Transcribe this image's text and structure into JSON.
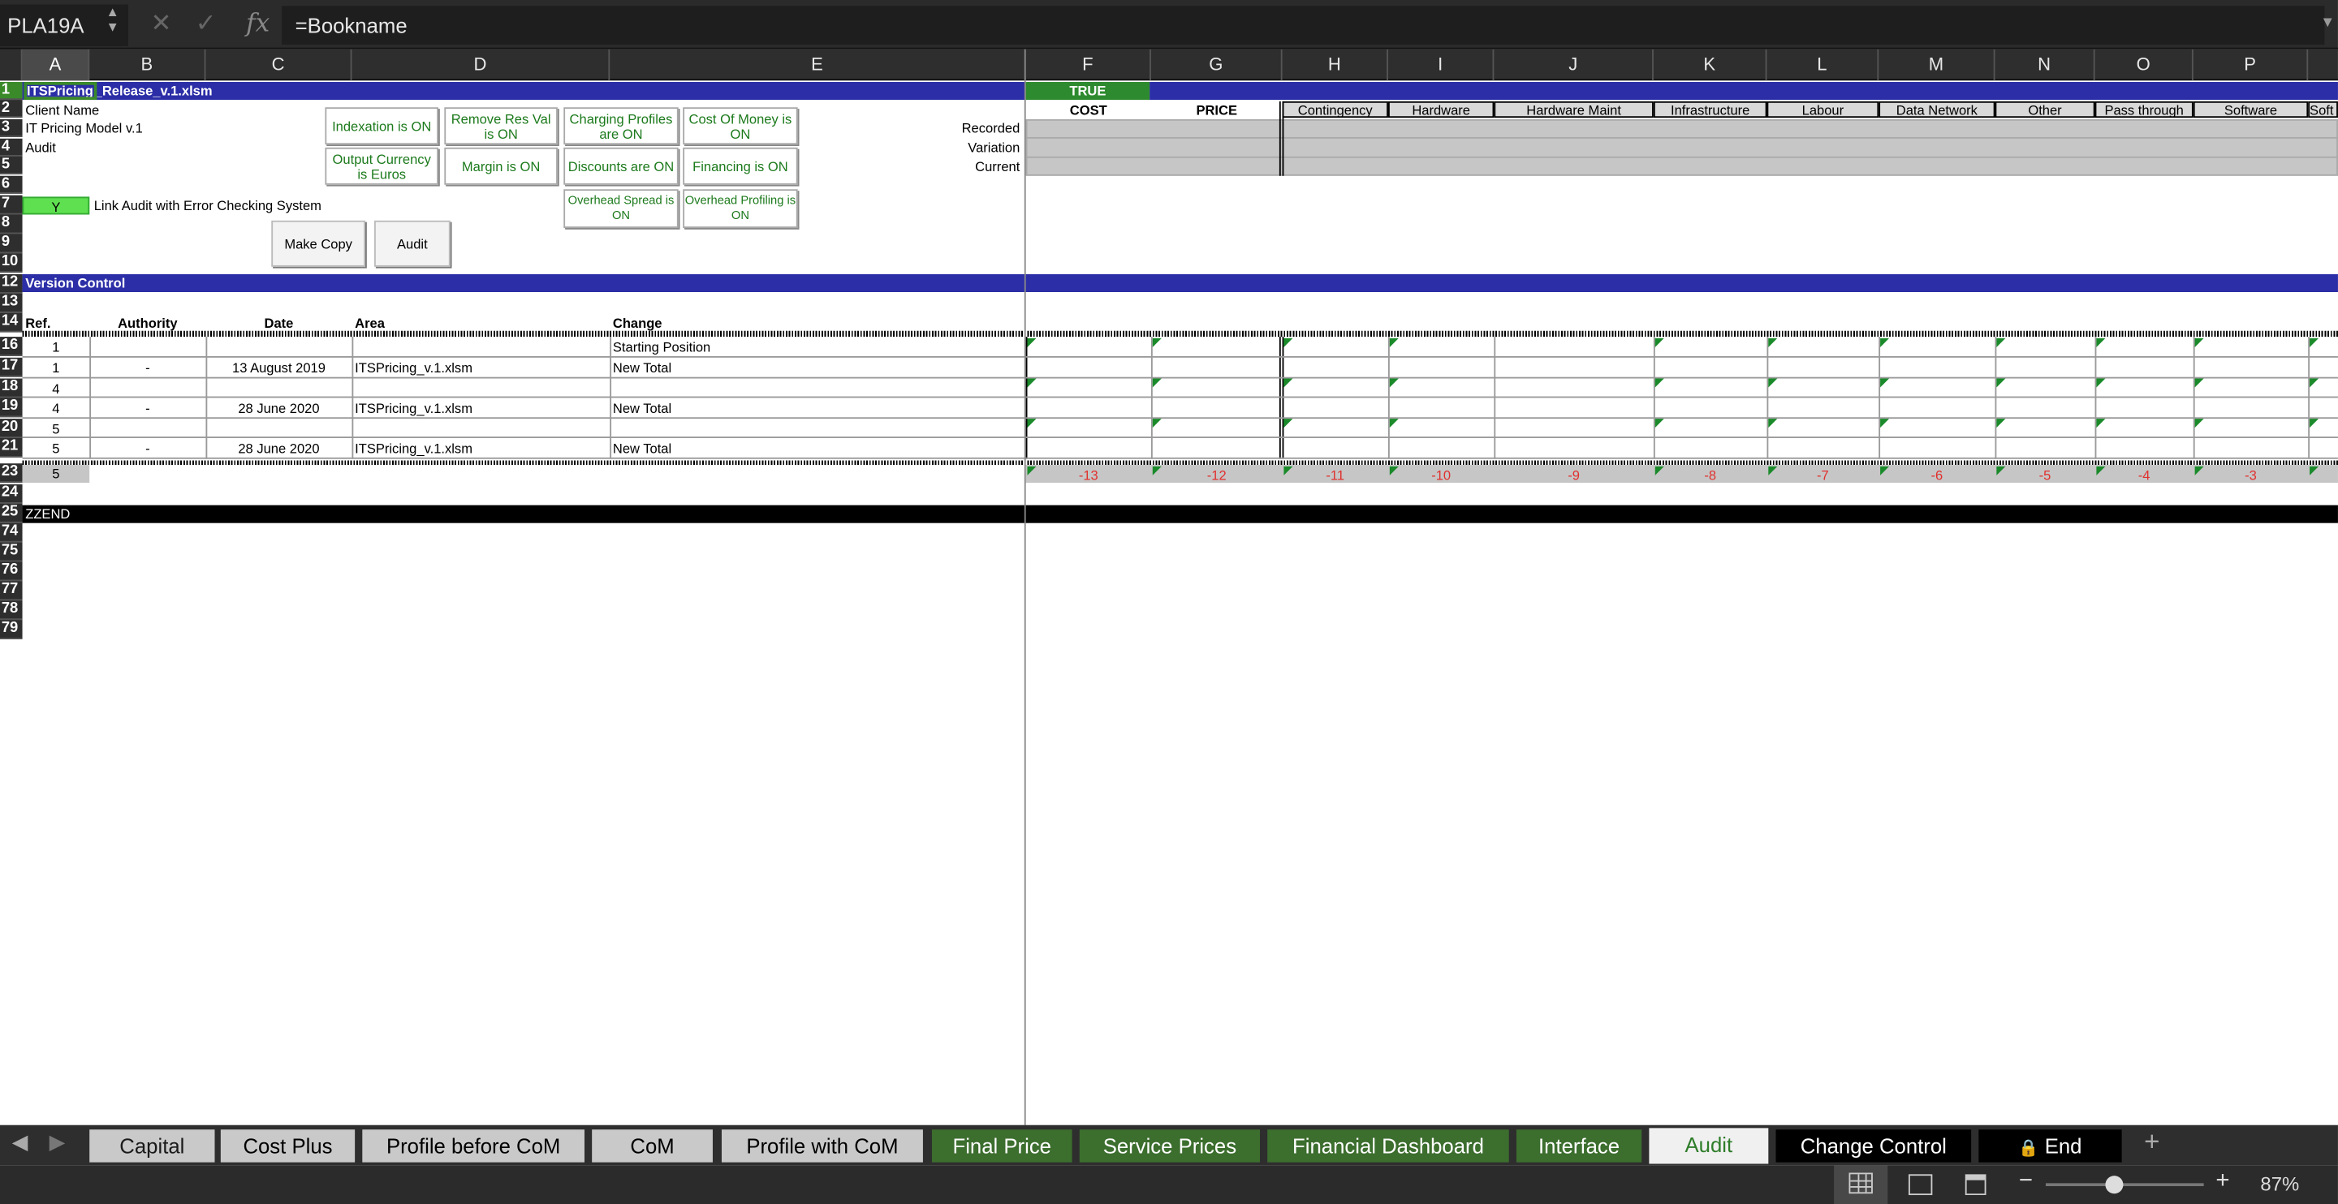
{
  "formula_bar": {
    "cell_ref": "PLA19A",
    "formula": "=Bookname"
  },
  "columns": [
    "A",
    "B",
    "C",
    "D",
    "E",
    "F",
    "G",
    "H",
    "I",
    "J",
    "K",
    "L",
    "M",
    "N",
    "O",
    "P"
  ],
  "rows": [
    "1",
    "2",
    "3",
    "4",
    "5",
    "6",
    "7",
    "8",
    "9",
    "10",
    "12",
    "13",
    "14",
    "16",
    "17",
    "18",
    "19",
    "20",
    "21",
    "23",
    "24",
    "25",
    "74",
    "75",
    "76",
    "77",
    "78",
    "79"
  ],
  "header": {
    "book_name_a": "ITSPricing",
    "book_name_b": "_Release_v.1.xlsm",
    "client_name": "Client Name",
    "model": "IT Pricing Model v.1",
    "audit": "Audit",
    "audit_flag": "Y",
    "link_audit": "Link Audit with Error Checking System",
    "true_flag": "TRUE"
  },
  "toggles": [
    "Indexation is ON",
    "Remove Res Val is ON",
    "Charging Profiles are ON",
    "Cost Of Money is ON",
    "Output Currency is Euros",
    "Margin is ON",
    "Discounts are ON",
    "Financing is ON",
    "Overhead Spread is ON",
    "Overhead Profiling is ON"
  ],
  "buttons": {
    "make_copy": "Make Copy",
    "audit": "Audit"
  },
  "summary": {
    "cost": "COST",
    "price": "PRICE",
    "categories": [
      "Contingency",
      "Hardware",
      "Hardware Maint",
      "Infrastructure",
      "Labour",
      "Data Network",
      "Other",
      "Pass through",
      "Software",
      "Soft"
    ],
    "row_labels": [
      "Recorded",
      "Variation",
      "Current"
    ]
  },
  "version_control": {
    "title": "Version Control",
    "headers": {
      "ref": "Ref.",
      "authority": "Authority",
      "date": "Date",
      "area": "Area",
      "change": "Change"
    },
    "rows": [
      {
        "ref": "1",
        "authority": "",
        "date": "",
        "area": "",
        "change": "Starting Position"
      },
      {
        "ref": "1",
        "authority": "-",
        "date": "13 August 2019",
        "area": "ITSPricing_v.1.xlsm",
        "change": "New Total"
      },
      {
        "ref": "4",
        "authority": "",
        "date": "",
        "area": "",
        "change": ""
      },
      {
        "ref": "4",
        "authority": "-",
        "date": "28 June 2020",
        "area": "ITSPricing_v.1.xlsm",
        "change": "New Total"
      },
      {
        "ref": "5",
        "authority": "",
        "date": "",
        "area": "",
        "change": ""
      },
      {
        "ref": "5",
        "authority": "-",
        "date": "28 June 2020",
        "area": "ITSPricing_v.1.xlsm",
        "change": "New Total"
      }
    ],
    "total_ref": "5"
  },
  "offsets": [
    "-13",
    "-12",
    "-11",
    "-10",
    "-9",
    "-8",
    "-7",
    "-6",
    "-5",
    "-4",
    "-3"
  ],
  "end_marker": "ZZEND",
  "tabs": [
    {
      "label": "Capital",
      "style": "grey"
    },
    {
      "label": "Cost Plus",
      "style": "grey"
    },
    {
      "label": "Profile before CoM",
      "style": "grey"
    },
    {
      "label": "CoM",
      "style": "grey"
    },
    {
      "label": "Profile with CoM",
      "style": "grey"
    },
    {
      "label": "Final Price",
      "style": "green"
    },
    {
      "label": "Service Prices",
      "style": "green"
    },
    {
      "label": "Financial Dashboard",
      "style": "green"
    },
    {
      "label": "Interface",
      "style": "green"
    },
    {
      "label": "Audit",
      "style": "active"
    },
    {
      "label": "Change Control",
      "style": "black"
    },
    {
      "label": "End",
      "style": "black-lock"
    }
  ],
  "zoom": "87%",
  "colors": {
    "band_blue": "#2b2ea6",
    "toggle_green": "#1c7a1c",
    "tab_green": "#3c6e2e",
    "negative_red": "#e0312e"
  }
}
